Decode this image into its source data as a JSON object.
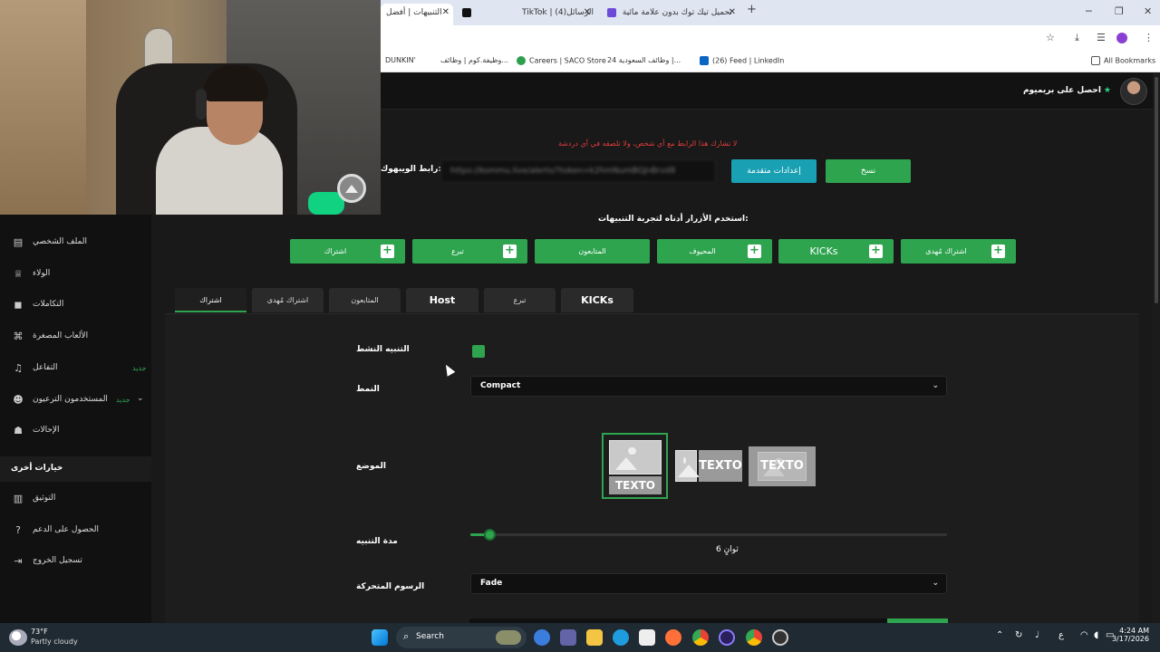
{
  "browser": {
    "tabs": [
      {
        "label": "التنبيهات | أفضل",
        "active": true
      },
      {
        "label": "",
        "icon": "tiktok"
      },
      {
        "label": "TikTok | الرسائل(4)"
      },
      {
        "label": "تحميل تيك توك بدون علامة مائية"
      }
    ],
    "new_tab": "+",
    "bookmarks": [
      "DUNKIN'",
      "وظيفة.كوم | وظائف...",
      "Careers | SACO Store",
      "وظائف السعودية 24 |...",
      "(26) Feed | LinkedIn",
      "All Bookmarks"
    ]
  },
  "header": {
    "premium_label": "احصل على بريميوم"
  },
  "alert_settings": {
    "warning": "لا تشارك هذا الرابط مع أي شخص، ولا تلصقه في أي دردشة",
    "webhook_label": "رابط الويبهوك:",
    "webhook_value": "https://kommu.live/alerts/?token=k2hmNumBGJnBrvd8",
    "advanced_button": "إعدادات متقدمة",
    "copy_button": "نسخ",
    "instructions": "استخدم الأزرار أدناه لتجربة التنبيهات:",
    "test_buttons": [
      "اشتراك",
      "تبرع",
      "المتابعون",
      "المحيوف",
      "KICKs",
      "اشتراك مُهدى"
    ],
    "tabs": [
      "اشتراك",
      "اشتراك مُهدى",
      "المتابعون",
      "Host",
      "تبرع",
      "KICKs"
    ],
    "active_tab": "اشتراك",
    "fields": {
      "enabled_label": "التنبيه النشط",
      "style_label": "النمط",
      "style_value": "Compact",
      "position_label": "الموضع",
      "position_text": "TEXTO",
      "duration_label": "مدة التنبيه",
      "duration_value": "6 ثوانٍ",
      "duration_fraction": 0.04,
      "animation_label": "الرسوم المتحركة",
      "animation_value": "Fade"
    }
  },
  "sidebar": {
    "items": [
      {
        "label": "الملف الشخصي",
        "icon": "id-card-icon"
      },
      {
        "label": "الولاء",
        "icon": "trophy-icon"
      },
      {
        "label": "التكاملات",
        "icon": "puzzle-icon"
      },
      {
        "label": "الألعاب المصغرة",
        "icon": "gamepad-icon"
      },
      {
        "label": "التفاعل",
        "icon": "music-icon",
        "badge": "جديد"
      },
      {
        "label": "المستخدمون الترعيون",
        "icon": "users-icon",
        "badge": "جديد"
      },
      {
        "label": "الإحالات",
        "icon": "user-group-icon"
      }
    ],
    "section_label": "خيارات أخرى",
    "other_items": [
      {
        "label": "التوثيق",
        "icon": "book-icon"
      },
      {
        "label": "الحصول على الدعم",
        "icon": "help-icon"
      },
      {
        "label": "تسجيل الخروج",
        "icon": "logout-icon"
      }
    ]
  },
  "taskbar": {
    "weather_temp": "73°F",
    "weather_desc": "Partly cloudy",
    "search_label": "Search",
    "time": "4:24 AM",
    "date": "3/17/2026"
  }
}
